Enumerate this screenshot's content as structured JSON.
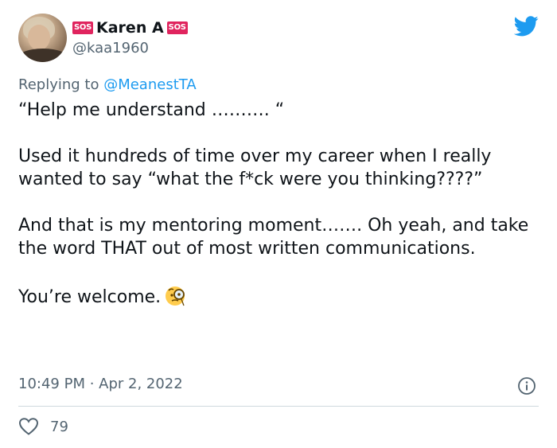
{
  "user": {
    "display_name": "Karen A",
    "badge_text": "SOS",
    "handle": "@kaa1960"
  },
  "reply": {
    "prefix": "Replying to ",
    "mention": "@MeanestTA"
  },
  "body": {
    "line1": "“Help me understand ………. “",
    "para2": "Used it hundreds of time over my career when I really wanted to say “what the f*ck were you thinking????”",
    "para3": "And that is my mentoring moment……. Oh yeah, and take the word THAT out of most written communications.",
    "para4": "You’re welcome.",
    "emoji": "face-with-monocle"
  },
  "timestamp": "10:49 PM · Apr 2, 2022",
  "likes": "79",
  "colors": {
    "text": "#0f1419",
    "secondary": "#536471",
    "link": "#1d9bf0",
    "twitter_blue": "#1d9bf0",
    "sos_badge": "#e0245e",
    "divider": "#cfd9de"
  }
}
